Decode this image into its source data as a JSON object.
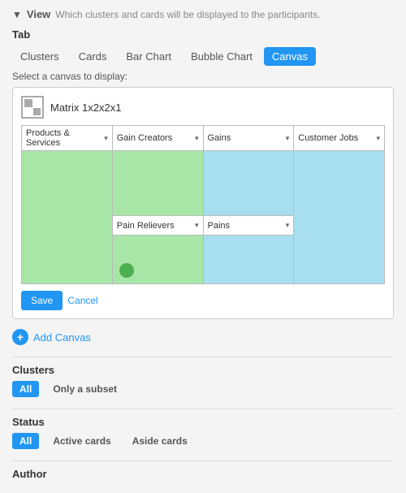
{
  "header": {
    "view_label": "View",
    "view_arrow": "▼",
    "view_desc": "Which clusters and cards will be displayed to the participants."
  },
  "tab_section": {
    "label": "Tab",
    "tabs": [
      {
        "id": "clusters",
        "label": "Clusters",
        "active": false
      },
      {
        "id": "cards",
        "label": "Cards",
        "active": false
      },
      {
        "id": "bar-chart",
        "label": "Bar Chart",
        "active": false
      },
      {
        "id": "bubble-chart",
        "label": "Bubble Chart",
        "active": false
      },
      {
        "id": "canvas",
        "label": "Canvas",
        "active": true
      }
    ],
    "select_label": "Select a canvas to display:"
  },
  "canvas_card": {
    "icon_label": "matrix-icon",
    "title": "Matrix 1x2x2x1",
    "columns": [
      "Products & Services",
      "Gain Creators",
      "Gains",
      "Customer Jobs"
    ],
    "mid_row_labels": [
      "Pain Relievers",
      "Pains"
    ],
    "save_btn": "Save",
    "cancel_btn": "Cancel"
  },
  "add_canvas": {
    "label": "Add Canvas"
  },
  "clusters_section": {
    "title": "Clusters",
    "badges": [
      {
        "label": "All",
        "active": true
      },
      {
        "label": "Only a subset",
        "active": false
      }
    ]
  },
  "status_section": {
    "title": "Status",
    "badges": [
      {
        "label": "All",
        "active": true
      },
      {
        "label": "Active cards",
        "active": false
      },
      {
        "label": "Aside cards",
        "active": false
      }
    ]
  },
  "author_section": {
    "title": "Author"
  }
}
